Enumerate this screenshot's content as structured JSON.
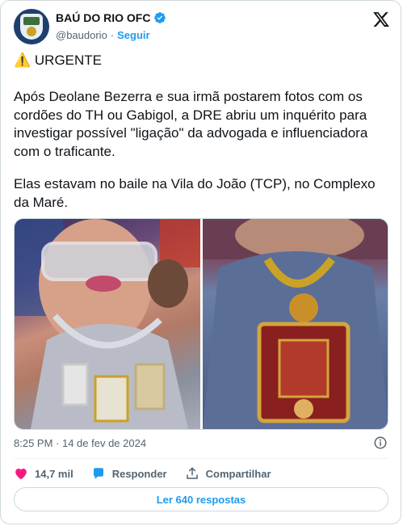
{
  "author": {
    "name": "BAÚ DO RIO OFC",
    "handle": "@baudorio",
    "separator": "·",
    "follow_label": "Seguir"
  },
  "tweet": {
    "urgent_line": "⚠️ URGENTE",
    "paragraph1": "Após Deolane Bezerra e sua irmã postarem fotos com os cordões do TH ou Gabigol, a DRE abriu um inquérito para investigar possível \"ligação\" da advogada e influenciadora com o traficante.",
    "paragraph2": "Elas estavam no baile na Vila do João (TCP), no Complexo da Maré.",
    "timestamp": "8:25 PM · 14 de fev de 2024"
  },
  "actions": {
    "likes": "14,7 mil",
    "reply_label": "Responder",
    "share_label": "Compartilhar"
  },
  "replies_button": "Ler 640 respostas",
  "colors": {
    "accent": "#1d9bf0",
    "like": "#f91880",
    "muted": "#536471"
  }
}
